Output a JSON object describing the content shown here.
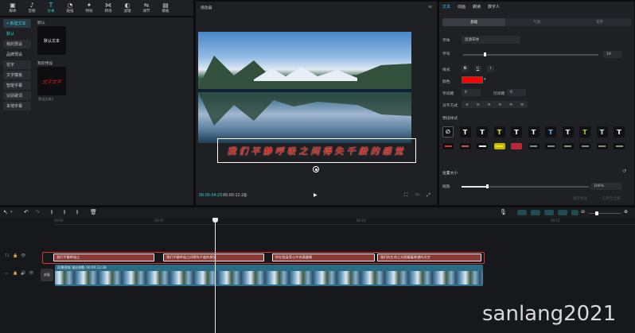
{
  "toolbar": {
    "items": [
      {
        "label": "媒体",
        "icon": "media-icon"
      },
      {
        "label": "音频",
        "icon": "audio-icon"
      },
      {
        "label": "文本",
        "icon": "text-icon"
      },
      {
        "label": "贴纸",
        "icon": "sticker-icon"
      },
      {
        "label": "特效",
        "icon": "effects-icon"
      },
      {
        "label": "转场",
        "icon": "transition-icon"
      },
      {
        "label": "滤镜",
        "icon": "filter-icon"
      },
      {
        "label": "调节",
        "icon": "adjust-icon"
      },
      {
        "label": "模板",
        "icon": "template-icon"
      }
    ],
    "active_index": 2
  },
  "leftnav": {
    "items": [
      "• 新建文本",
      "默认",
      "我的预设",
      "花字",
      "文字模板",
      "智能字幕",
      "识别歌词",
      "本地字幕"
    ],
    "extra": [
      "品牌预设"
    ]
  },
  "assets": {
    "section_default": "默认",
    "default_card": "默认文本",
    "section_mypreset": "我的预设",
    "mypreset_card_label": "预设文本1"
  },
  "player": {
    "title": "播放器",
    "caption": "我们平静呼吸之间得失千般的感觉",
    "time_current": "00:00:04:25",
    "time_total": "00:00:12:28"
  },
  "props": {
    "tabs": [
      "文本",
      "动画",
      "朗读",
      "数字人"
    ],
    "subtabs": [
      "基础",
      "气泡",
      "花字"
    ],
    "font_label": "字体",
    "font_value": "思源宋体",
    "size_label": "字号",
    "size_value": "10",
    "style_label": "样式",
    "style_buttons": [
      "B",
      "U",
      "I"
    ],
    "color_label": "颜色",
    "color_value": "#ff0000",
    "char_spacing_label": "字间距",
    "char_spacing_value": "0",
    "line_spacing_label": "行间距",
    "line_spacing_value": "0",
    "align_label": "对齐方式",
    "preset_label": "预设样式",
    "position_label": "位置大小",
    "scale_label": "缩放",
    "scale_value": "100%",
    "bottom_buttons": [
      "保存预设",
      "应用至全部"
    ]
  },
  "timeline": {
    "ruler": [
      "00:00",
      "00:05",
      "00:10",
      "00:15"
    ],
    "text_clips": [
      "我们平静呼吸之",
      "我们平静呼吸之间得失千般的感觉",
      "你在我身旁心中充满激情",
      "我们的生命之光照耀着希望的天空"
    ],
    "video_clip_label": "风景视频 湖泊倒影  00:00:12:28",
    "cover_label": "封面",
    "track_label_text": "T1"
  },
  "watermark": "sanlang2021",
  "colors": {
    "accent": "#2fd1d1",
    "clip_text": "#8a3a34",
    "selection": "#e0322a",
    "video": "#2a6c86"
  }
}
